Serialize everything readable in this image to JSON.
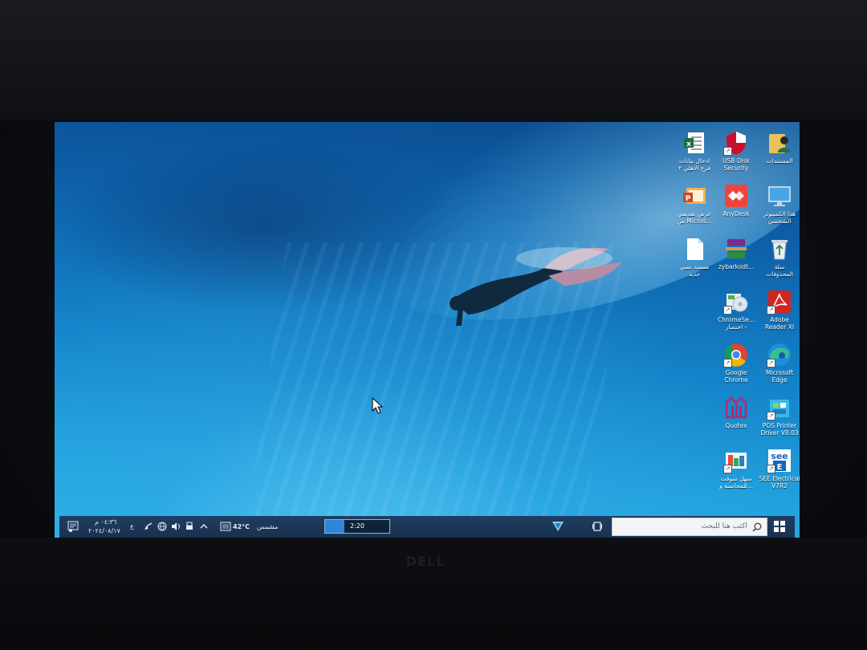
{
  "monitor": {
    "brand": "DELL"
  },
  "desktop": {
    "icons": [
      {
        "id": "my-documents",
        "line1": "المستندات",
        "line2": ""
      },
      {
        "id": "usb-disk-security",
        "line1": "USB Disk",
        "line2": "Security"
      },
      {
        "id": "excel-file",
        "line1": "ادخال بيانات",
        "line2": "فرع الاهلي ٢"
      },
      {
        "id": "this-pc",
        "line1": "هذا الكمبيوتر",
        "line2": "الشخصي"
      },
      {
        "id": "anydesk",
        "line1": "AnyDesk",
        "line2": ""
      },
      {
        "id": "microsoft-office-file",
        "line1": "عرض تقديمي",
        "line2": "من Micros..."
      },
      {
        "id": "recycle-bin",
        "line1": "سلة",
        "line2": "المحذوفات"
      },
      {
        "id": "winrar-archive",
        "line1": "zybarkodt...",
        "line2": ""
      },
      {
        "id": "new-text-document",
        "line1": "مستند نصي",
        "line2": "جديد"
      },
      {
        "id": "adobe-reader",
        "line1": "Adobe",
        "line2": "Reader XI"
      },
      {
        "id": "chromesetup-shortcut",
        "line1": "ChromeSe...",
        "line2": "اختصار -"
      },
      {
        "id": "microsoft-edge",
        "line1": "Microsoft",
        "line2": "Edge"
      },
      {
        "id": "google-chrome",
        "line1": "Google",
        "line2": "Chrome"
      },
      {
        "id": "pos-printer-driver",
        "line1": "POS Printer",
        "line2": "Driver V8.03"
      },
      {
        "id": "quotex",
        "line1": "Quotex",
        "line2": ""
      },
      {
        "id": "see-electrical",
        "line1": "SEE Electrical",
        "line2": "V7R2"
      },
      {
        "id": "sahl-software",
        "line1": "سهل سوفت",
        "line2": "للمحاسبة و..."
      }
    ]
  },
  "taskbar": {
    "search_placeholder": "اكتب هنا للبحث",
    "timer_label": "2:20",
    "timer_progress": 0.3,
    "weather_temp": "42°C",
    "weather_desc": "مشمس",
    "clock_time": "٠٤:٣٦ م",
    "clock_date": "٢٠٢٤/٠٨/١٧",
    "language": "ع"
  },
  "colors": {
    "taskbar": "#1f3d63",
    "water_dark": "#0c4a8c",
    "water_light": "#2bb0e6",
    "search_box": "#f3f4f6"
  }
}
